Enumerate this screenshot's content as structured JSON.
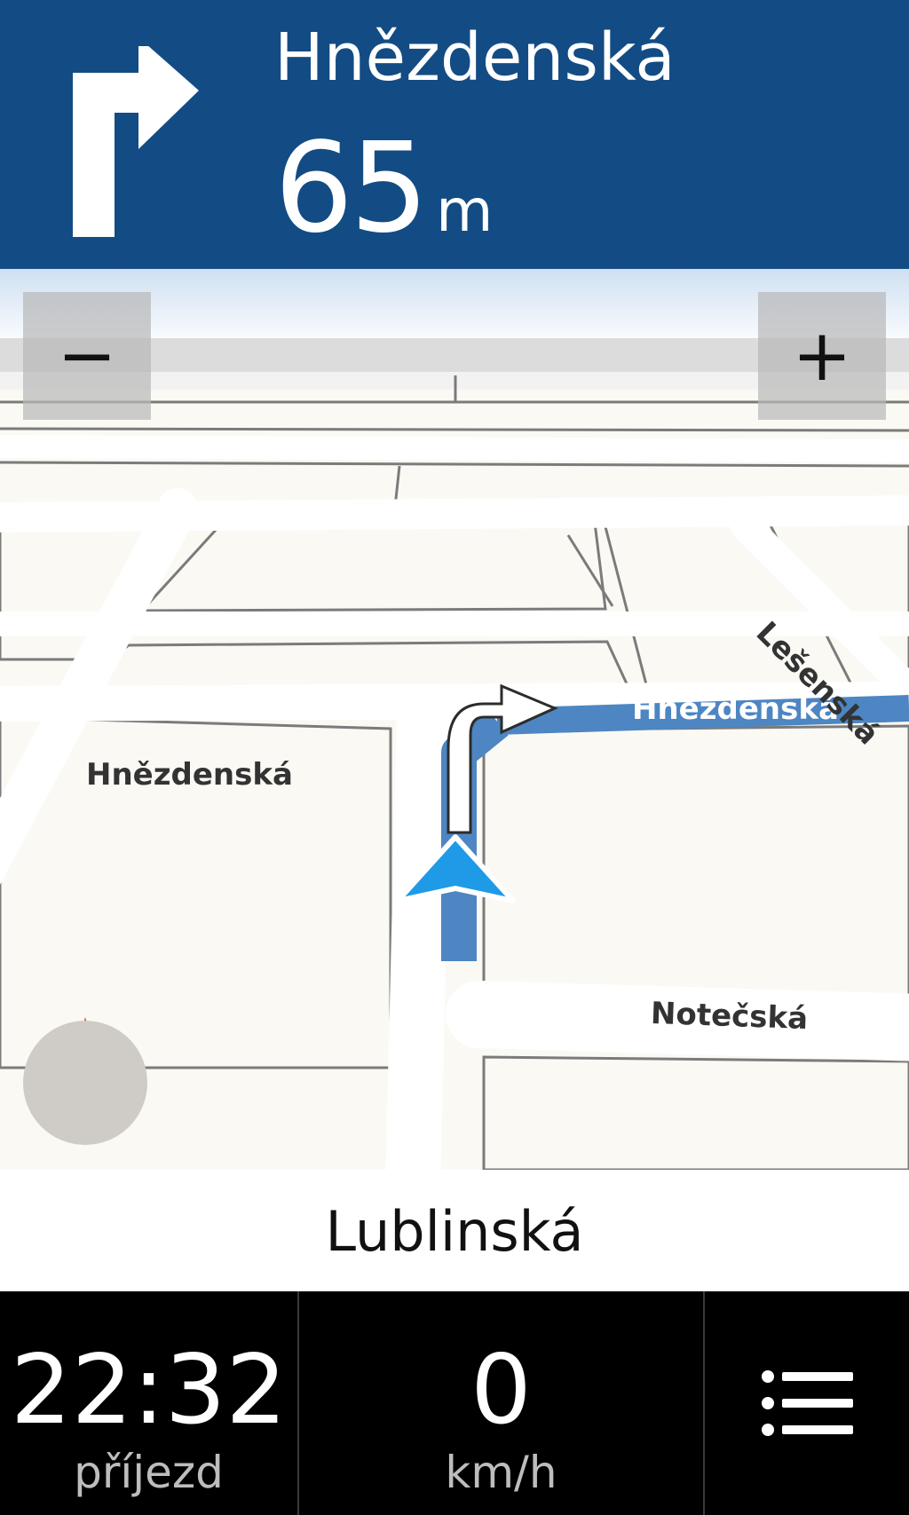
{
  "instruction": {
    "street": "Hnězdenská",
    "distance_value": "65",
    "distance_unit": "m",
    "maneuver_icon": "turn-right-arrow-icon"
  },
  "map": {
    "zoom_out_label": "−",
    "zoom_in_label": "+",
    "compass_icon": "compass-icon",
    "street_labels": [
      "Hnězdenská",
      "Hnězdenská",
      "Lešenská",
      "Notečská"
    ],
    "current_street": "Lublinská"
  },
  "status": {
    "arrival_time": "22:32",
    "arrival_label": "příjezd",
    "speed": "0",
    "speed_unit": "km/h",
    "menu_icon": "menu-list-icon"
  },
  "colors": {
    "banner": "#134c84",
    "route": "#4d86c2",
    "position_arrow": "#1e9ae6",
    "map_land": "#fbf9f4"
  }
}
